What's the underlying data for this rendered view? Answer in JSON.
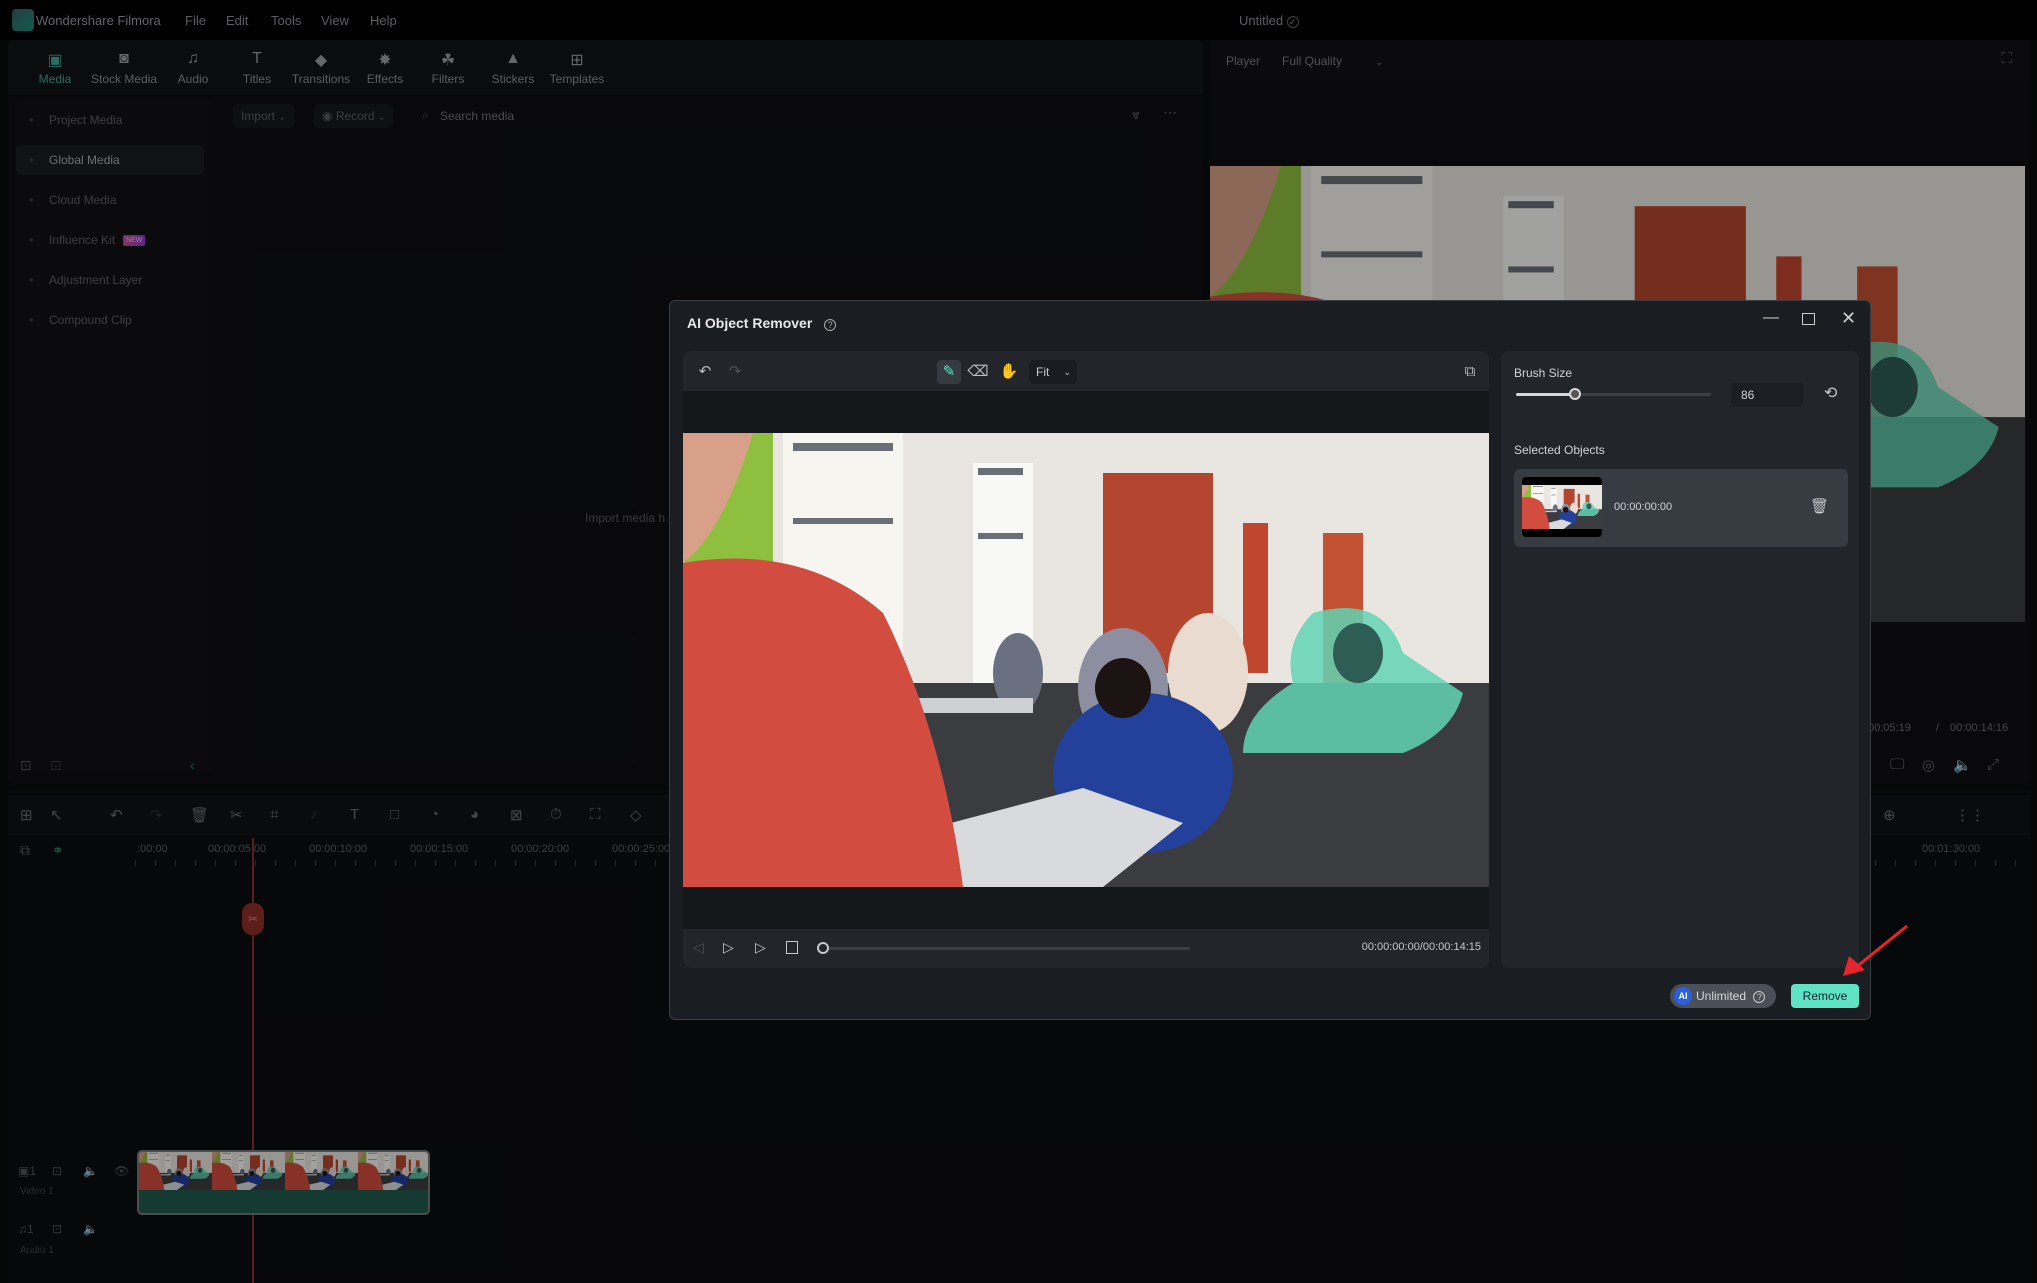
{
  "app": {
    "name": "Wondershare Filmora",
    "project": "Untitled",
    "menu": [
      "File",
      "Edit",
      "Tools",
      "View",
      "Help"
    ]
  },
  "tabs": [
    {
      "label": "Media",
      "icon": "media-icon",
      "active": true
    },
    {
      "label": "Stock Media",
      "icon": "stock-media-icon"
    },
    {
      "label": "Audio",
      "icon": "music-note-icon"
    },
    {
      "label": "Titles",
      "icon": "title-t-icon"
    },
    {
      "label": "Transitions",
      "icon": "transitions-icon"
    },
    {
      "label": "Effects",
      "icon": "effects-icon"
    },
    {
      "label": "Filters",
      "icon": "filters-icon"
    },
    {
      "label": "Stickers",
      "icon": "stickers-icon"
    },
    {
      "label": "Templates",
      "icon": "templates-icon"
    }
  ],
  "sidebar": {
    "items": [
      {
        "label": "Project Media"
      },
      {
        "label": "Global Media",
        "active": true
      },
      {
        "label": "Cloud Media"
      },
      {
        "label": "Influence Kit",
        "badge": "NEW"
      },
      {
        "label": "Adjustment Layer"
      },
      {
        "label": "Compound Clip"
      }
    ]
  },
  "media_toolbar": {
    "import": "Import",
    "record": "Record",
    "search_placeholder": "Search media"
  },
  "media_empty": "Import media h",
  "player": {
    "label": "Player",
    "quality": "Full Quality",
    "current_time": "00:05:19",
    "total_time": "00:00:14:16",
    "separator": "/"
  },
  "timeline": {
    "ruler": [
      ":00:00",
      "00:00:05:00",
      "00:00:10:00",
      "00:00:15:00",
      "00:00:20:00",
      "00:00:25:00",
      "00:01:30:00"
    ],
    "tracks": [
      {
        "label": "Video 1",
        "num": "1"
      },
      {
        "label": "Audio 1",
        "num": "1"
      }
    ]
  },
  "dialog": {
    "title": "AI Object Remover",
    "zoom": "Fit",
    "brush_size_label": "Brush Size",
    "brush_size": "86",
    "brush_fraction": 0.3,
    "selected_objects_label": "Selected Objects",
    "objects": [
      {
        "time": "00:00:00:00"
      }
    ],
    "timecode": "00:00:00:00/00:00:14:15",
    "progress": 0,
    "unlimited": "Unlimited",
    "remove": "Remove"
  },
  "colors": {
    "accent": "#5fe3c2",
    "active_tab": "#3fa996",
    "playhead": "#c0392b",
    "arrow": "#e8242c"
  }
}
